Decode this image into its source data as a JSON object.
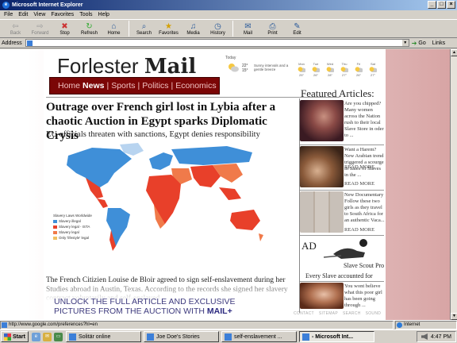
{
  "window": {
    "title": "Microsoft Internet Explorer",
    "controls": [
      "_",
      "□",
      "×"
    ]
  },
  "menu": [
    "File",
    "Edit",
    "View",
    "Favorites",
    "Tools",
    "Help"
  ],
  "toolbar": {
    "back": "Back",
    "forward": "Forward",
    "stop": "Stop",
    "refresh": "Refresh",
    "home": "Home",
    "search": "Search",
    "favorites": "Favorites",
    "media": "Media",
    "history": "History",
    "mail": "Mail",
    "print": "Print",
    "edit": "Edit"
  },
  "address": {
    "label": "Address",
    "value": "",
    "go": "Go",
    "links": "Links"
  },
  "site": {
    "brand_light": "Forlester",
    "brand_bold": "Mail",
    "nav": {
      "home": "Home",
      "news": "News",
      "sports": "Sports",
      "politics": "Politics",
      "economics": "Economics",
      "sep": "|"
    }
  },
  "weather": {
    "today": "Today",
    "temp_high": "22°",
    "temp_low": "15°",
    "desc": "Sunny intervals and a gentle breeze",
    "days": [
      {
        "day": "Mon",
        "temp": "25°"
      },
      {
        "day": "Tue",
        "temp": "26°"
      },
      {
        "day": "Wed",
        "temp": "28°"
      },
      {
        "day": "Thu",
        "temp": "27°"
      },
      {
        "day": "Fri",
        "temp": "26°"
      },
      {
        "day": "Sat",
        "temp": "27°"
      }
    ]
  },
  "article": {
    "headline": "Outrage over French girl lost in Lybia after a chaotic Auction in Egypt sparks Diplomatic Crysis",
    "subhead": "EU officials threaten with sanctions, Egypt denies responsibility",
    "body": "The French Citizien Louise de Bloir agreed to sign self-enslavement during her  Studies abroad in Austin, Texas. According to the records she signed her slavery contract voluntarily and self-enslaved",
    "unlock_line1": "UNLOCK THE FULL ARTICLE AND EXCLUSIVE",
    "unlock_line2": "PICTURES FROM THE AUCTION WITH ",
    "unlock_brand": "MAIL+"
  },
  "map_legend": {
    "title": "Slavery Laws Worldwide",
    "items": [
      {
        "label": "Slavery illegal",
        "color": "#3f8fd8"
      },
      {
        "label": "Slavery legal - ISTA",
        "color": "#e8402a"
      },
      {
        "label": "Slavery legal",
        "color": "#f07a4a"
      },
      {
        "label": "Only 'lifestyle' legal",
        "color": "#f0c060"
      }
    ]
  },
  "sidebar": {
    "heading": "Featured Articles:",
    "articles": [
      {
        "blurb": "Are you chipped? Many women across the Nation rush to their local Slave Store in oder to ...",
        "more": "READ MORE"
      },
      {
        "blurb": "Want a Harem? New Arabian trend triggered a scourge in Sales of Slaves in the ...",
        "more": "READ MORE"
      },
      {
        "blurb": "New Documentary Follow these two girls as they travel to South Africa for an authentic Vaca...",
        "more": "READ MORE"
      }
    ],
    "ad_label": "AD",
    "ad_title": "Slave Scout Pro",
    "ad_sub": "Every Slave accounted for",
    "last_blurb": "You wont believe what this poor girl has been going through ..."
  },
  "footer_links": [
    "CONTACT",
    "SITEMAP",
    "SEARCH",
    "SOUND"
  ],
  "status": {
    "url": "http://www.google.com/preferences?hl=en",
    "zone": "Internet"
  },
  "taskbar": {
    "start": "Start",
    "tasks": [
      {
        "label": "Solitär online",
        "active": false
      },
      {
        "label": "Joe Doe's Stories",
        "active": false
      },
      {
        "label": "self-enslavement ...",
        "active": false
      },
      {
        "label": "- Microsoft Int...",
        "active": true
      }
    ],
    "time": "4:47 PM"
  },
  "colors": {
    "titlebar_start": "#0a246a",
    "nav_bg": "#7b0606",
    "slavery_illegal": "#3f8fd8",
    "slavery_legal_ista": "#e8402a",
    "slavery_legal": "#f07a4a",
    "unlock_text": "#3e3b7e"
  }
}
